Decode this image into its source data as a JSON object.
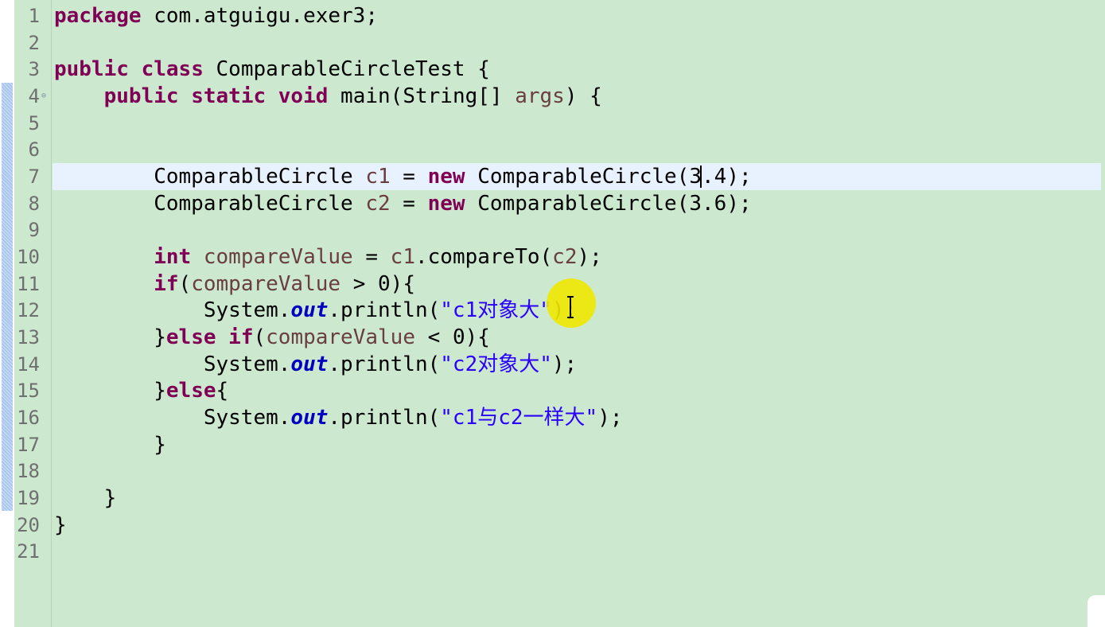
{
  "editor": {
    "line_numbers": [
      "1",
      "2",
      "3",
      "4",
      "5",
      "6",
      "7",
      "8",
      "9",
      "10",
      "11",
      "12",
      "13",
      "14",
      "15",
      "16",
      "17",
      "18",
      "19",
      "20",
      "21"
    ],
    "lines": {
      "l1": [
        "package",
        " com.atguigu.exer3;"
      ],
      "l3": [
        "public",
        " ",
        "class",
        " ComparableCircleTest {"
      ],
      "l4": [
        "    ",
        "public",
        " ",
        "static",
        " ",
        "void",
        " main(String[] ",
        "args",
        ") {"
      ],
      "l7": [
        "        ComparableCircle ",
        "c1",
        " = ",
        "new",
        " ComparableCircle(3.4);"
      ],
      "l8": [
        "        ComparableCircle ",
        "c2",
        " = ",
        "new",
        " ComparableCircle(3.6);"
      ],
      "l10": [
        "        ",
        "int",
        " ",
        "compareValue",
        " = ",
        "c1",
        ".compareTo(",
        "c2",
        ");"
      ],
      "l11": [
        "        ",
        "if",
        "(",
        "compareValue",
        " > 0){"
      ],
      "l12": [
        "            System.",
        "out",
        ".println(",
        "\"c1对象大\"",
        ");"
      ],
      "l13": [
        "        }",
        "else",
        " ",
        "if",
        "(",
        "compareValue",
        " < 0){"
      ],
      "l14": [
        "            System.",
        "out",
        ".println(",
        "\"c2对象大\"",
        ");"
      ],
      "l15": [
        "        }",
        "else",
        "{"
      ],
      "l16": [
        "            System.",
        "out",
        ".println(",
        "\"c1与c2一样大\"",
        ");"
      ],
      "l17": [
        "        }"
      ],
      "l19": [
        "    }"
      ],
      "l20": [
        "}"
      ]
    },
    "colors": {
      "background": "#cce8cf",
      "keyword": "#7f0055",
      "local_variable": "#6a3e3e",
      "string": "#2a00ff",
      "static_field": "#0000c0",
      "current_line": "#e8f2ff",
      "cursor_highlight": "#f0e800"
    }
  }
}
